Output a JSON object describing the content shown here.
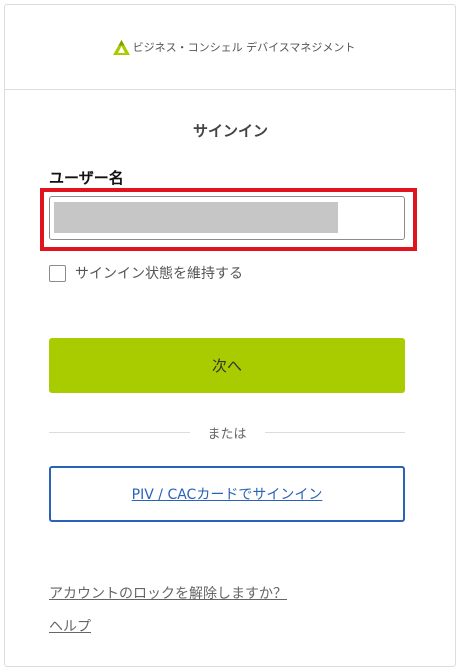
{
  "header": {
    "logo_icon": "brand-triangle-logo",
    "logo_text": "ビジネス・コンシェル デバイスマネジメント",
    "brand_color": "#a8cc00"
  },
  "form": {
    "title": "サインイン",
    "username_label": "ユーザー名",
    "username_value": "",
    "highlight_color": "#e0141e",
    "remember_label": "サインイン状態を維持する",
    "remember_checked": false,
    "next_button": "次へ",
    "separator_text": "または",
    "piv_button": "PIV / CACカードでサインイン",
    "piv_color": "#2a62b8"
  },
  "links": {
    "unlock": "アカウントのロックを解除しますか？",
    "help": "ヘルプ"
  }
}
